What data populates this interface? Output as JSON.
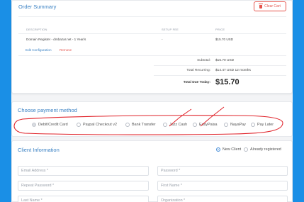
{
  "order_summary": {
    "title": "Order Summary",
    "clear_cart_label": "Clear Cart",
    "columns": {
      "description": "DESCRIPTION",
      "setup_fee": "SETUP FEE",
      "price": "PRICE"
    },
    "item": {
      "description": "Domain Register - dmbazar.net - 1 Year/s",
      "setup_fee": "-",
      "price": "$15.70 USD"
    },
    "edit_label": "Edit Configuration",
    "remove_label": "Remove",
    "subtotal_label": "Subtotal:",
    "subtotal_value": "$15.70 USD",
    "recurring_label": "Total Recurring:",
    "recurring_value": "$14.47 USD 12 months",
    "due_label": "Total Due Today:",
    "due_value": "$15.70"
  },
  "payment": {
    "title": "Choose payment method",
    "options": [
      {
        "label": "Debit/Credit Card",
        "selected": true
      },
      {
        "label": "Paypal Checkout v2",
        "selected": false
      },
      {
        "label": "Bank Transfer",
        "selected": false
      },
      {
        "label": "Jazz Cash",
        "selected": false
      },
      {
        "label": "EasyPaisa",
        "selected": false
      },
      {
        "label": "NayaPay",
        "selected": false
      },
      {
        "label": "Pay Later",
        "selected": false
      }
    ]
  },
  "client": {
    "title": "Client Information",
    "new_client_label": "New Client",
    "existing_label": "Already registered",
    "fields": {
      "email": "Email Address *",
      "password": "Password *",
      "repeat_password": "Repeat Password *",
      "first_name": "First Name *",
      "last_name": "Last Name *",
      "organization": "Organization *"
    }
  },
  "colors": {
    "accent": "#3b82c4",
    "danger": "#e5534b",
    "background": "#1a8fe6",
    "annotation": "#e0242b"
  }
}
